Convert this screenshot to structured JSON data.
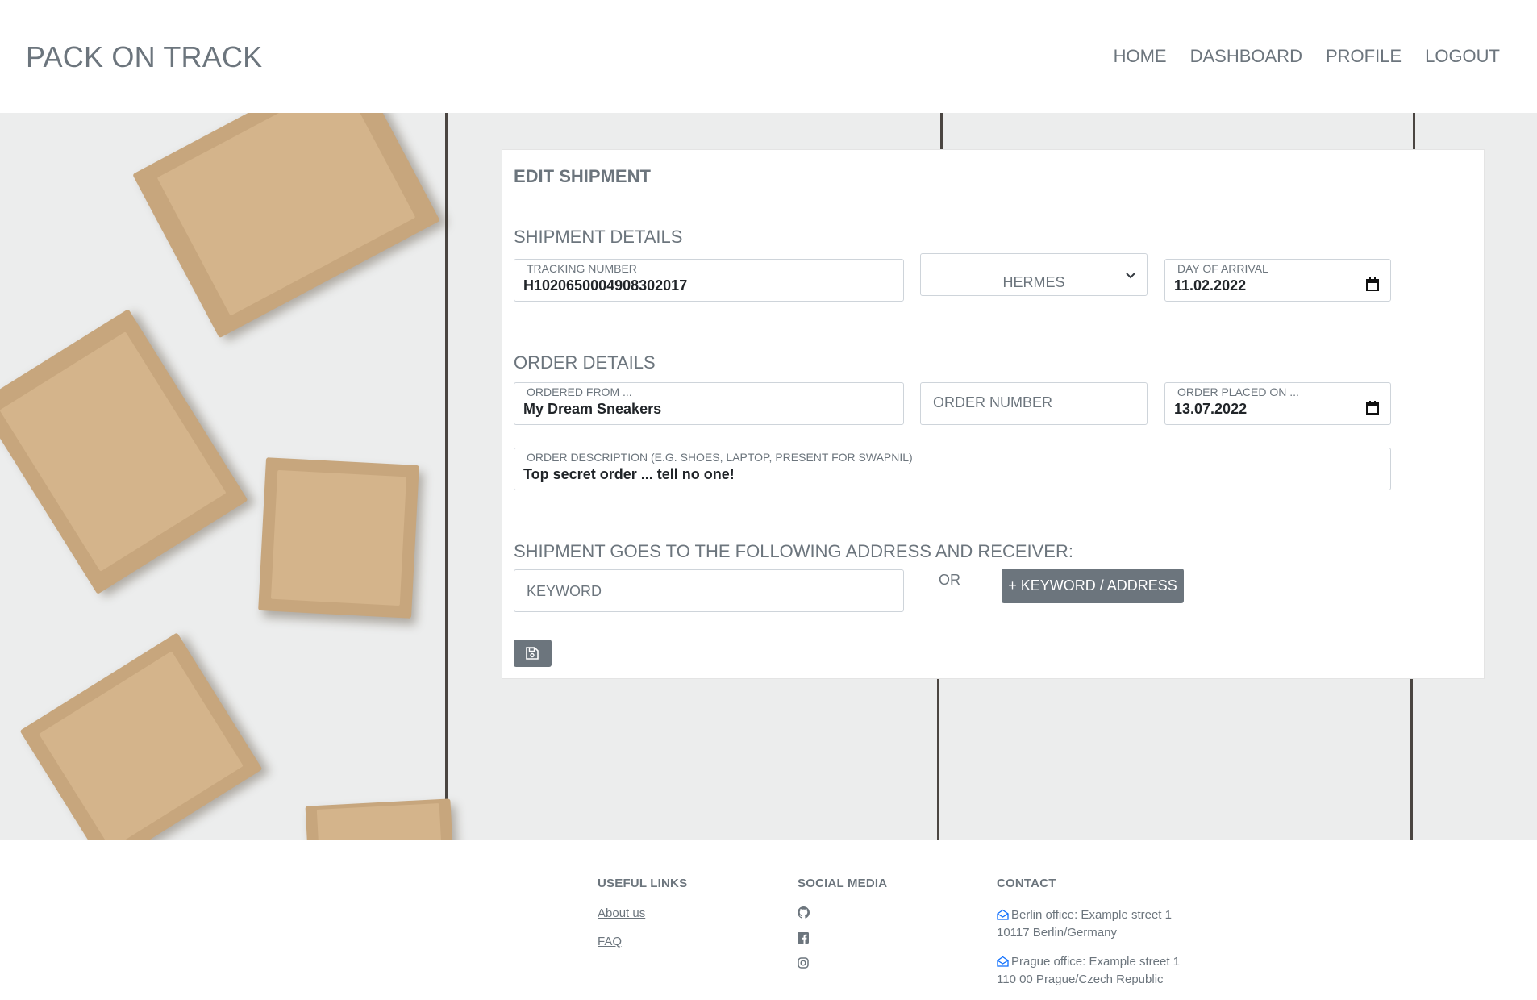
{
  "app": {
    "brand": "PACK ON TRACK"
  },
  "nav": {
    "items": [
      {
        "label": "HOME"
      },
      {
        "label": "DASHBOARD"
      },
      {
        "label": "PROFILE"
      },
      {
        "label": "LOGOUT"
      }
    ]
  },
  "form": {
    "title": "EDIT SHIPMENT",
    "shipment_section": "SHIPMENT DETAILS",
    "tracking": {
      "label": "TRACKING NUMBER",
      "value": "H1020650004908302017"
    },
    "carrier": {
      "selected": "HERMES"
    },
    "arrival": {
      "label": "DAY OF ARRIVAL",
      "value": "11.02.2022"
    },
    "order_section": "ORDER DETAILS",
    "ordered_from": {
      "label": "ORDERED FROM ...",
      "value": "My Dream Sneakers"
    },
    "order_number": {
      "placeholder": "ORDER NUMBER"
    },
    "order_placed": {
      "label": "ORDER PLACED ON ...",
      "value": "13.07.2022"
    },
    "description": {
      "label": "ORDER DESCRIPTION (E.G. SHOES, LAPTOP, PRESENT FOR SWAPNIL)",
      "value": "Top secret order ... tell no one!"
    },
    "address_section": "SHIPMENT GOES TO THE FOLLOWING ADDRESS AND RECEIVER:",
    "keyword": {
      "placeholder": "KEYWORD"
    },
    "or_label": "OR",
    "add_button": "+ KEYWORD / ADDRESS",
    "save_icon": "floppy-disk-icon"
  },
  "footer": {
    "useful_links": {
      "heading": "USEFUL LINKS",
      "links": [
        "About us",
        "FAQ"
      ]
    },
    "social": {
      "heading": "SOCIAL MEDIA",
      "icons": [
        "github-icon",
        "facebook-icon",
        "instagram-icon"
      ]
    },
    "contact": {
      "heading": "CONTACT",
      "offices": [
        {
          "line1": "Berlin office: Example street 1",
          "line2": "10117 Berlin/Germany"
        },
        {
          "line1": "Prague office: Example street 1",
          "line2": "110 00 Prague/Czech Republic"
        }
      ]
    }
  }
}
